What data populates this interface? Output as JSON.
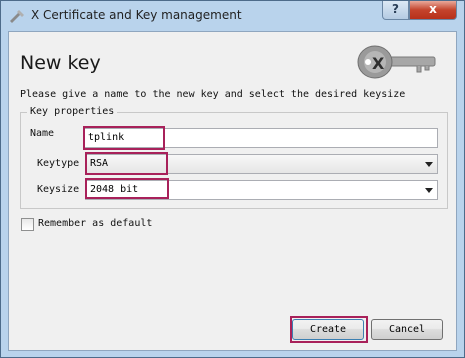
{
  "window": {
    "title": "X Certificate and Key management",
    "help_glyph": "?",
    "close_glyph": "x"
  },
  "dialog": {
    "heading": "New key",
    "instruction": "Please give a name to the new key and select the desired keysize",
    "group_title": "Key properties",
    "name_label": "Name",
    "name_value": "tplink",
    "keytype_label": "Keytype",
    "keytype_value": "RSA",
    "keysize_label": "Keysize",
    "keysize_value": "2048 bit",
    "remember_label": "Remember as default",
    "remember_checked": false
  },
  "buttons": {
    "create": "Create",
    "cancel": "Cancel"
  },
  "colors": {
    "highlight": "#a8215a",
    "titlebar": "#b9d3ec",
    "close_button": "#c4432c"
  }
}
